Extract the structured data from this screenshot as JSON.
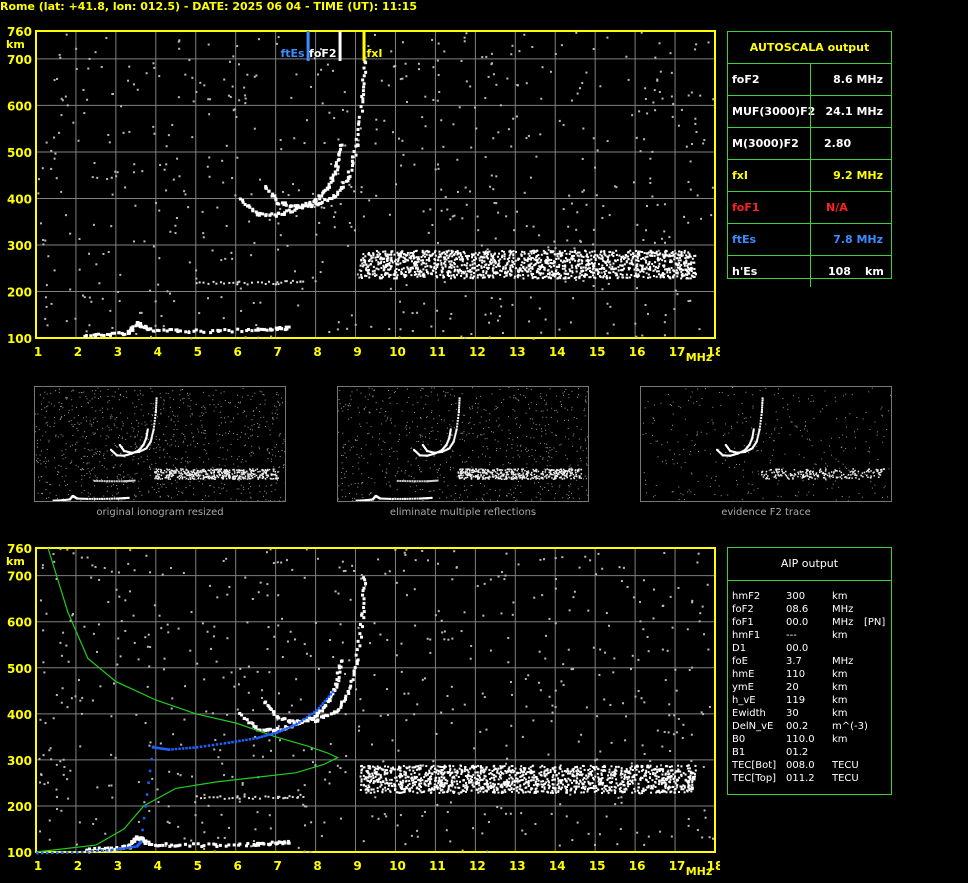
{
  "header": {
    "title": "Rome (lat: +41.8, lon: 012.5) - DATE: 2025 06 04 - TIME (UT): 11:15"
  },
  "colors": {
    "axis": "#ffff00",
    "grid": "#808080",
    "border": "#3ad13a",
    "fto_trace": "#2060ff",
    "profile": "#22cc22",
    "foF1": "#ff2020",
    "ftEs": "#3b8cff",
    "fxI": "#ffff00"
  },
  "markers": {
    "ftEs": "ftEs",
    "foF2": "foF2",
    "fxI": "fxI"
  },
  "autoscala": {
    "title": "AUTOSCALA output",
    "rows": [
      {
        "label": "foF2",
        "value": "8.6 MHz",
        "color": "#ffffff"
      },
      {
        "label": "MUF(3000)F2",
        "value": "24.1 MHz",
        "color": "#ffffff"
      },
      {
        "label": "M(3000)F2",
        "value": "2.80",
        "color": "#ffffff"
      },
      {
        "label": "fxI",
        "value": "9.2 MHz",
        "color": "#ffff00"
      },
      {
        "label": "foF1",
        "value": "N/A",
        "color": "#ff2020"
      },
      {
        "label": "ftEs",
        "value": "7.8 MHz",
        "color": "#3b8cff"
      }
    ],
    "hEs": {
      "label": "h'Es",
      "value": "108",
      "unit": "km"
    }
  },
  "aip": {
    "title": "AIP output",
    "rows": [
      {
        "param": "hmF2",
        "value": "300",
        "unit": "km",
        "extra": ""
      },
      {
        "param": "foF2",
        "value": "08.6",
        "unit": "MHz",
        "extra": ""
      },
      {
        "param": "foF1",
        "value": "00.0",
        "unit": "MHz",
        "extra": "[PN]"
      },
      {
        "param": "hmF1",
        "value": "---",
        "unit": "km",
        "extra": ""
      },
      {
        "param": "D1",
        "value": "00.0",
        "unit": "",
        "extra": ""
      },
      {
        "param": "foE",
        "value": "3.7",
        "unit": "MHz",
        "extra": ""
      },
      {
        "param": "hmE",
        "value": "110",
        "unit": "km",
        "extra": ""
      },
      {
        "param": "ymE",
        "value": "20",
        "unit": "km",
        "extra": ""
      },
      {
        "param": "h_vE",
        "value": "119",
        "unit": "km",
        "extra": ""
      },
      {
        "param": "Ewidth",
        "value": "30",
        "unit": "km",
        "extra": ""
      },
      {
        "param": "DelN_vE",
        "value": "00.2",
        "unit": "m^(-3)",
        "extra": ""
      },
      {
        "param": "B0",
        "value": "110.0",
        "unit": "km",
        "extra": ""
      },
      {
        "param": "B1",
        "value": "01.2",
        "unit": "",
        "extra": ""
      },
      {
        "param": "TEC[Bot]",
        "value": "008.0",
        "unit": "TECU",
        "extra": ""
      },
      {
        "param": "TEC[Top]",
        "value": "011.2",
        "unit": "TECU",
        "extra": ""
      }
    ]
  },
  "thumbnails": {
    "captions": [
      "original ionogram resized",
      "eliminate multiple reflections",
      "evidence F2 trace"
    ]
  },
  "chart_data": [
    {
      "type": "scatter",
      "name": "ionogram_autoscala",
      "xlabel": "MHz",
      "ylabel": "km",
      "xlim": [
        1,
        18
      ],
      "ylim": [
        100,
        760
      ],
      "x_ticks": [
        "1",
        "2",
        "3",
        "4",
        "5",
        "6",
        "7",
        "8",
        "9",
        "10",
        "11",
        "12",
        "13",
        "14",
        "15",
        "16",
        "17",
        "18"
      ],
      "y_ticks": [
        "100",
        "200",
        "300",
        "400",
        "500",
        "600",
        "700",
        "760"
      ],
      "grid": true,
      "markers": [
        {
          "label": "ftEs",
          "x": 7.8
        },
        {
          "label": "foF2",
          "x": 8.6
        },
        {
          "label": "fxI",
          "x": 9.2
        }
      ],
      "traces": {
        "E_trace": {
          "x": [
            2.2,
            2.8,
            3.3,
            3.5,
            3.6,
            3.8,
            4.5,
            5.5,
            6.5,
            7.0,
            7.3
          ],
          "y": [
            108,
            110,
            115,
            135,
            130,
            120,
            118,
            118,
            120,
            122,
            124
          ]
        },
        "Es_trace": {
          "x": [
            5.0,
            6.0,
            7.0,
            7.7
          ],
          "y": [
            222,
            220,
            220,
            224
          ]
        },
        "F2_o_trace": {
          "x": [
            6.1,
            6.5,
            7.0,
            7.5,
            8.0,
            8.3,
            8.5,
            8.6
          ],
          "y": [
            402,
            370,
            368,
            380,
            400,
            430,
            470,
            520
          ]
        },
        "F2_x_trace": {
          "x": [
            6.7,
            7.0,
            7.5,
            8.0,
            8.5,
            8.8,
            9.0,
            9.15,
            9.2
          ],
          "y": [
            430,
            395,
            385,
            390,
            410,
            450,
            520,
            620,
            700
          ]
        },
        "spread_band": {
          "x_range": [
            9.1,
            17.5
          ],
          "y_range": [
            230,
            290
          ]
        }
      }
    },
    {
      "type": "scatter",
      "name": "ionogram_aip",
      "xlabel": "MHz",
      "ylabel": "km",
      "xlim": [
        1,
        18
      ],
      "ylim": [
        100,
        760
      ],
      "grid": true,
      "profile": {
        "x": [
          1.3,
          1.8,
          2.3,
          3.0,
          4.0,
          5.0,
          6.0,
          7.0,
          7.8,
          8.3,
          8.55,
          8.2,
          7.5,
          6.5,
          5.5,
          4.5,
          3.7,
          3.2,
          2.5,
          1.0
        ],
        "y": [
          760,
          620,
          520,
          470,
          430,
          400,
          380,
          350,
          330,
          315,
          305,
          290,
          272,
          262,
          252,
          238,
          200,
          150,
          115,
          100
        ]
      },
      "true_height": {
        "x": [
          1.0,
          2.0,
          3.0,
          3.5,
          3.6,
          3.9,
          4.3,
          5.0,
          5.8,
          6.5,
          7.0,
          7.5,
          8.0,
          8.4
        ],
        "y": [
          100,
          102,
          108,
          115,
          125,
          330,
          325,
          330,
          340,
          350,
          362,
          380,
          410,
          450
        ]
      }
    }
  ]
}
